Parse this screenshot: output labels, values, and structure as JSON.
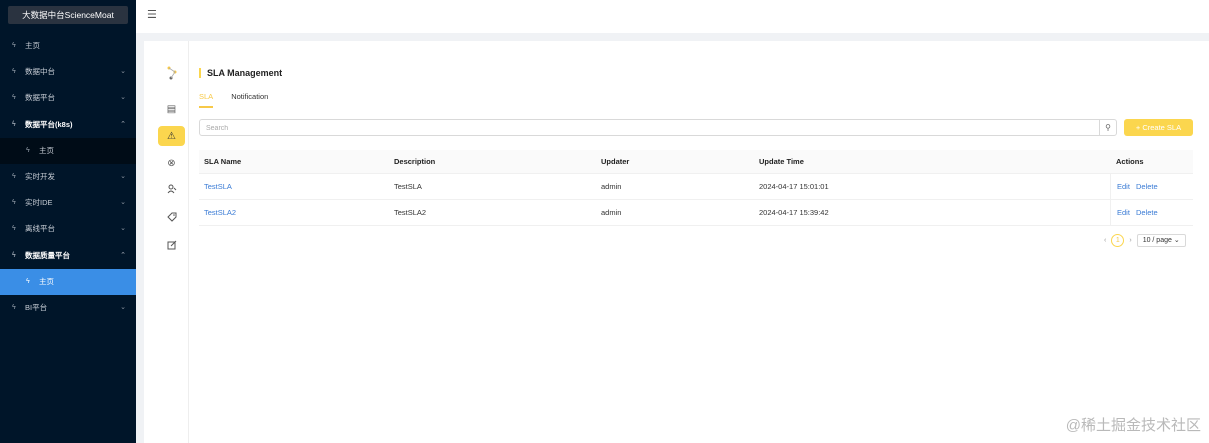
{
  "sidebar": {
    "brand": "大数据中台ScienceMoat",
    "items": [
      {
        "label": "主页"
      },
      {
        "label": "数据中台"
      },
      {
        "label": "数据平台"
      },
      {
        "label": "数据平台(k8s)"
      },
      {
        "label": "主页"
      },
      {
        "label": "实时开发"
      },
      {
        "label": "实时IDE"
      },
      {
        "label": "离线平台"
      },
      {
        "label": "数据质量平台"
      },
      {
        "label": "主页"
      },
      {
        "label": "BI平台"
      }
    ]
  },
  "page": {
    "title": "SLA Management",
    "tabs": [
      "SLA",
      "Notification"
    ],
    "search_placeholder": "Search",
    "create_label": "+ Create SLA"
  },
  "table": {
    "headers": [
      "SLA Name",
      "Description",
      "Updater",
      "Update Time",
      "Actions"
    ],
    "rows": [
      {
        "name": "TestSLA",
        "description": "TestSLA",
        "updater": "admin",
        "time": "2024-04-17 15:01:01",
        "edit": "Edit",
        "delete": "Delete"
      },
      {
        "name": "TestSLA2",
        "description": "TestSLA2",
        "updater": "admin",
        "time": "2024-04-17 15:39:42",
        "edit": "Edit",
        "delete": "Delete"
      }
    ]
  },
  "pagination": {
    "page": "1",
    "page_size": "10 / page"
  },
  "watermark": "@稀土掘金技术社区",
  "colors": {
    "sidebar_bg": "#001529",
    "active_menu": "#3a8ee6",
    "accent": "#fbd64e",
    "link": "#3a7bd5"
  },
  "icons": [
    "menu-fold-icon",
    "sla-logo-icon",
    "list-icon",
    "warning-icon",
    "close-circle-icon",
    "users-icon",
    "tag-icon",
    "edit-icon",
    "search-icon"
  ]
}
